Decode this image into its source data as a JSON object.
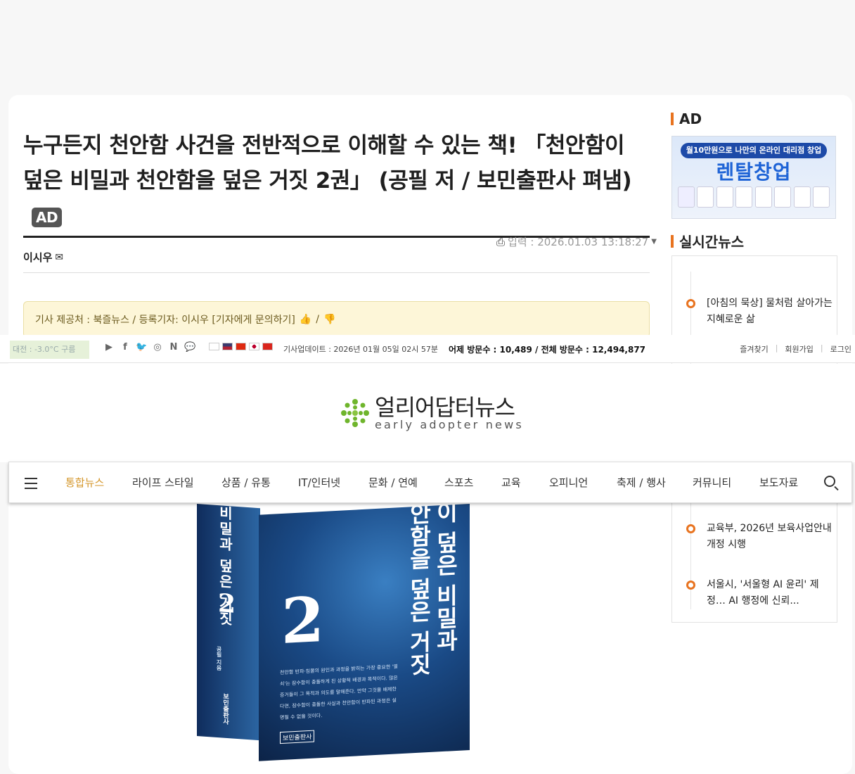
{
  "article": {
    "headline": "누구든지 천안함 사건을 전반적으로 이해할 수 있는 책! 「천안함이 덮은 비밀과 천안함을 덮은 거짓 2권」 (공필 저 / 보민출판사 펴냄)",
    "ad_badge": "AD",
    "date": "입력 : 2026.01.03 13:18:27",
    "author": "이시우",
    "notice": "기사 제공처 : 북즐뉴스 / 등록기자: 이시우 [기자에게 문의하기]",
    "notice_sep": "/"
  },
  "sidebar": {
    "ad_title": "AD",
    "ad_banner": {
      "top_text": "월10만원으로 나만의 온라인 대리점 창업",
      "main_text": "렌탈창업"
    },
    "news_title": "실시간뉴스",
    "news": [
      {
        "title": "[아침의 묵상] 물처럼 살아가는 지혜로운 삶"
      },
      {
        "title": "교육부, 2026년 보육사업안내 개정 시행"
      },
      {
        "title": "서울시, '서울형 AI 윤리' 제정… AI 행정에 신뢰..."
      }
    ]
  },
  "topbar": {
    "weather": "대전 : -3.0°C 구름",
    "social_icons": [
      "youtube-icon",
      "facebook-icon",
      "twitter-icon",
      "instagram-icon",
      "naver-icon",
      "talk-icon"
    ],
    "flags": [
      "kr",
      "us",
      "cn",
      "jp",
      "vn"
    ],
    "update": "기사업데이트 : 2026년 01월 05일 02시 57분",
    "visits": "어제 방문수 : 10,489 / 전체 방문수 : 12,494,877",
    "links": [
      "즐겨찾기",
      "회원가입",
      "로그인"
    ]
  },
  "logo": {
    "ko": "얼리어답터뉴스",
    "en": "early adopter news"
  },
  "nav": {
    "items": [
      "통합뉴스",
      "라이프 스타일",
      "상품 / 유통",
      "IT/인터넷",
      "문화 / 연예",
      "스포츠",
      "교육",
      "오피니언",
      "축제 / 행사",
      "커뮤니티",
      "보도자료"
    ]
  },
  "book": {
    "spine_title": "비밀과 덮은 거짓",
    "spine_num": "2",
    "spine_author": "공필 지음",
    "spine_pub": "보민출판사",
    "front_title_1": "이 덮은 비밀과",
    "front_title_2": "안함을 덮은 거짓",
    "front_num": "2",
    "blurb": "천안함 반파·침몰의 원인과 과정을 밝히는 가장 중요한 '열쇠'는 잠수함이 충돌하게 된 상황적 배경과 목적이다. 많은 증거들이 그 목적과 의도를 말해준다. 만약 그것을 배제한다면, 잠수함이 충돌한 사실과 천안함이 반파된 과정은 설명될 수 없을 것이다.",
    "front_pub": "보민출판사"
  },
  "colors": {
    "accent": "#e8731f",
    "nav_active": "#d4962a",
    "notice_bg": "#fdf6d8"
  }
}
